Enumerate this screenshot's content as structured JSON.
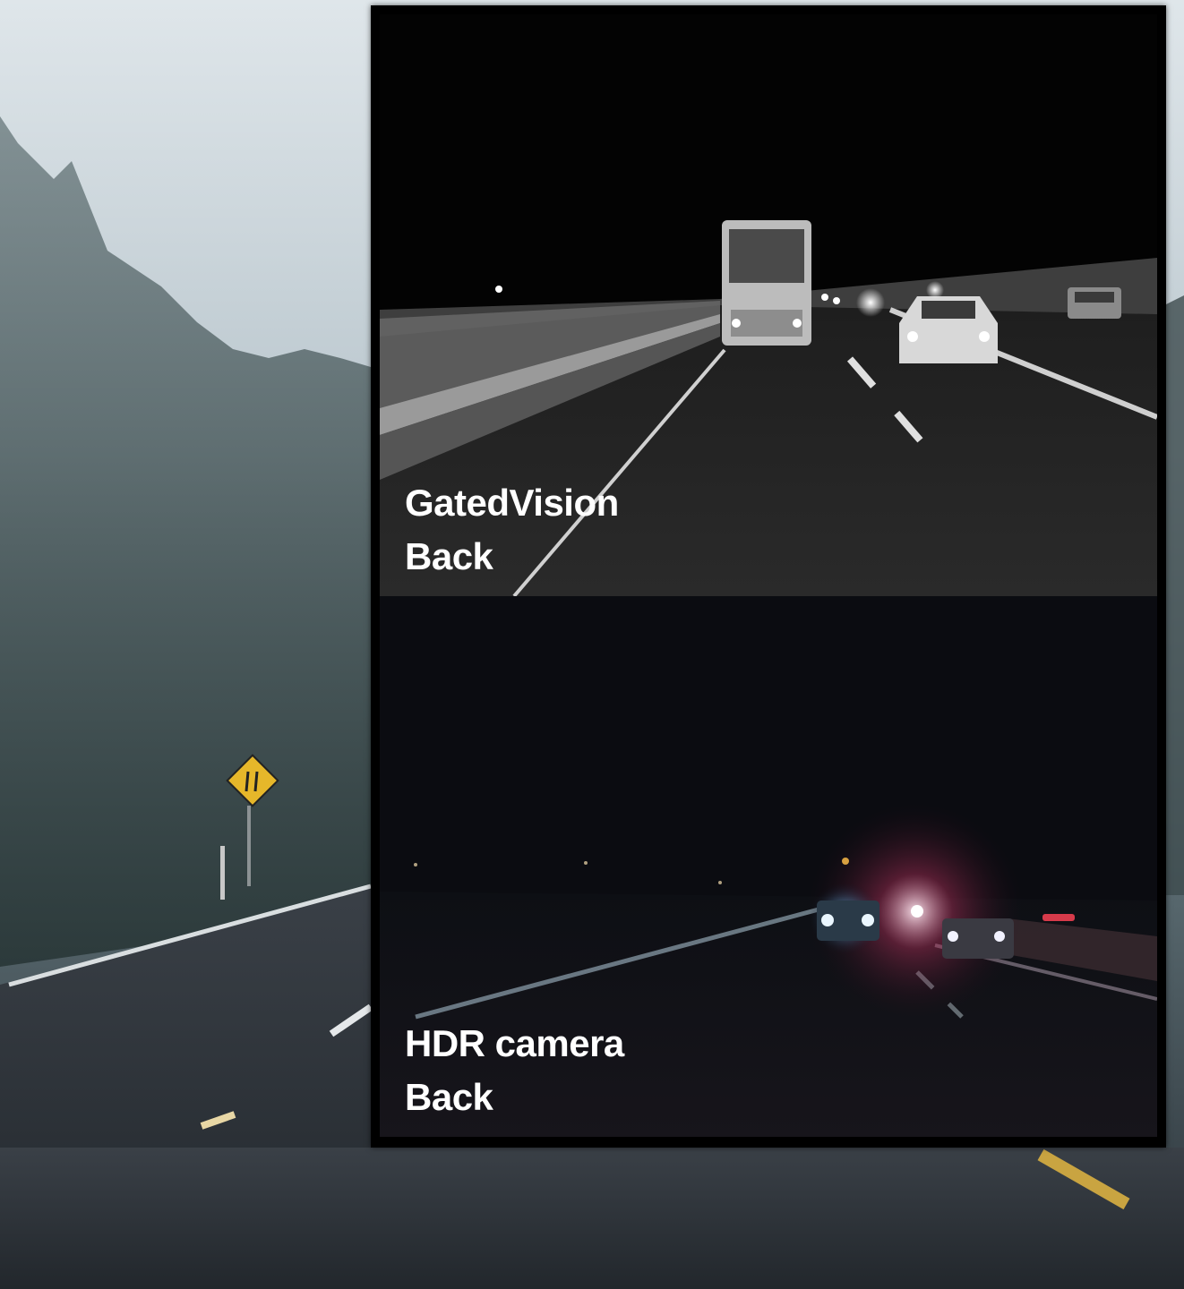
{
  "background_scene": {
    "description_icon": "foggy-road-icon",
    "sign_icon": "lane-merge-sign-icon"
  },
  "panels": [
    {
      "title": "GatedVision",
      "subtitle": "Back"
    },
    {
      "title": "HDR camera",
      "subtitle": "Back"
    }
  ],
  "colors": {
    "fog": "#c9d3d8",
    "forest": "#3b4a4e",
    "road": "#2c3137",
    "sign": "#e6b72a",
    "frame": "#000000",
    "caption": "#ffffff"
  }
}
